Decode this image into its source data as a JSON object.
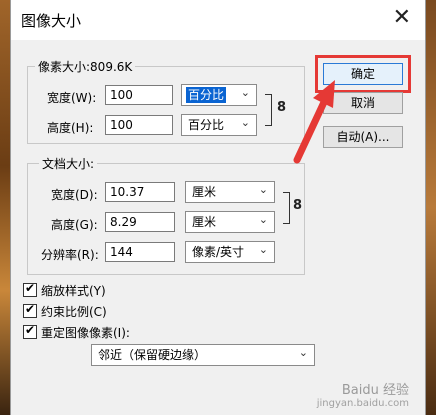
{
  "window": {
    "title": "图像大小",
    "close_glyph": "✕"
  },
  "pixel_dimensions": {
    "label": "像素大小:809.6K",
    "width_label": "宽度(W):",
    "width_value": "100",
    "width_unit": "百分比",
    "height_label": "高度(H):",
    "height_value": "100",
    "height_unit": "百分比"
  },
  "document_size": {
    "label": "文档大小:",
    "width_label": "宽度(D):",
    "width_value": "10.37",
    "width_unit": "厘米",
    "height_label": "高度(G):",
    "height_value": "8.29",
    "height_unit": "厘米",
    "resolution_label": "分辨率(R):",
    "resolution_value": "144",
    "resolution_unit": "像素/英寸"
  },
  "buttons": {
    "ok": "确定",
    "cancel": "取消",
    "auto": "自动(A)..."
  },
  "options": {
    "scale_styles": "缩放样式(Y)",
    "constrain_proportions": "约束比例(C)",
    "resample": "重定图像像素(I):",
    "resample_method": "邻近（保留硬边缘）"
  },
  "icons": {
    "chain": "link-icon",
    "dropdown": "chevron-down-icon",
    "check": "checkmark-icon"
  },
  "glyphs": {
    "arrow": "⌄",
    "tick": "✔",
    "chain": "8"
  },
  "colors": {
    "highlight_box": "#e53935",
    "selection": "#0a64d2"
  },
  "watermark": {
    "line1": "Baidu 经验",
    "line2": "jingyan.baidu.com"
  }
}
